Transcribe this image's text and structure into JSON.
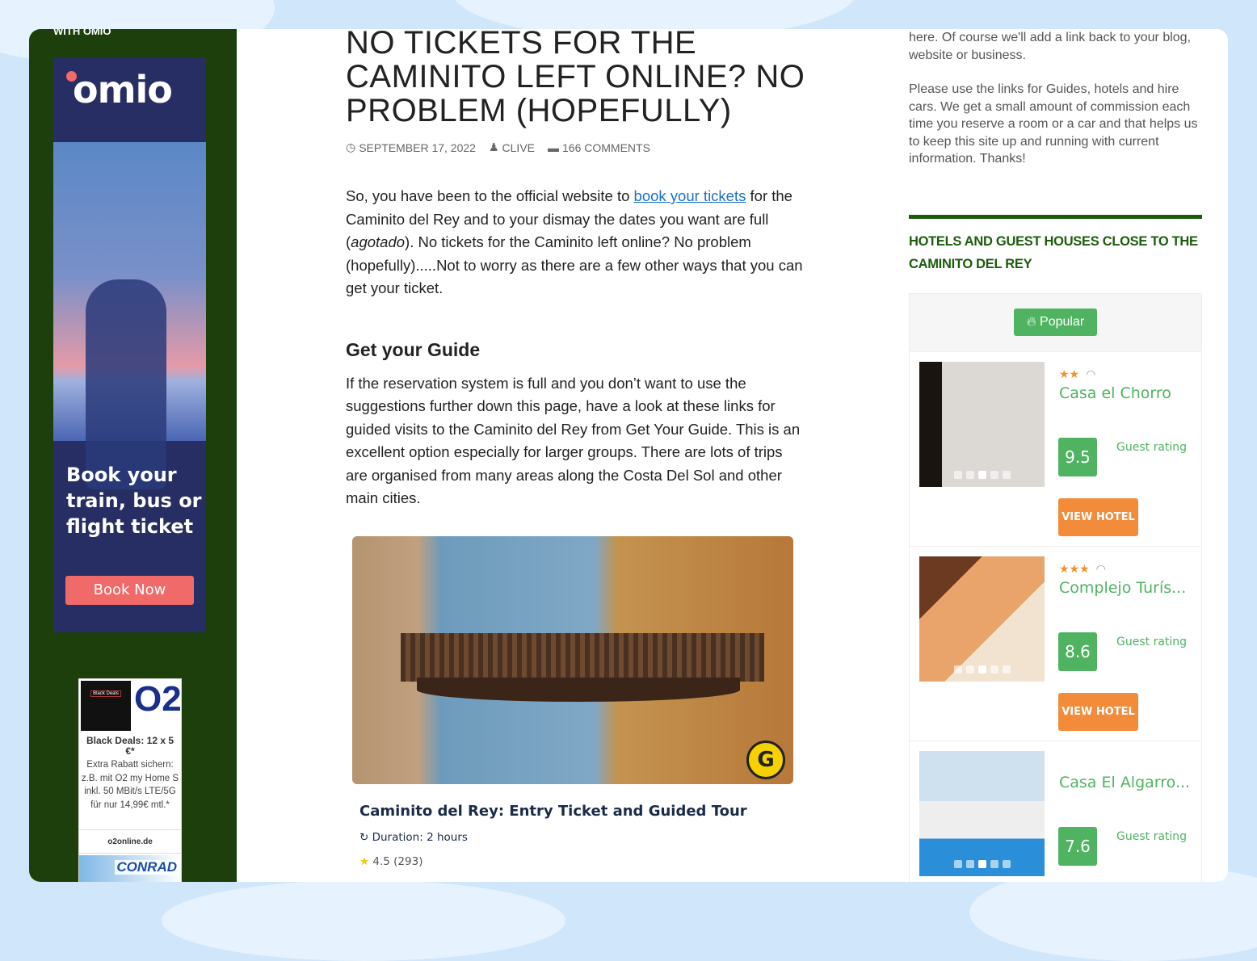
{
  "sidebar": {
    "heading": "WITH OMIO",
    "omio_ad": {
      "logo": "omio",
      "text": "Book your train, bus or flight ticket",
      "button": "Book Now"
    },
    "o2_ad": {
      "badge": "Black Deals",
      "logo": "O2",
      "headline": "Black Deals: 12 x 5 €*",
      "text": "Extra Rabatt sichern: z.B. mit O2 my Home S inkl. 50 MBit/s LTE/5G für nur 14,99€ mtl.*",
      "site": "o2online.de",
      "next_ad": "CONRAD"
    }
  },
  "article": {
    "title": "NO TICKETS FOR THE CAMINITO LEFT ONLINE? NO PROBLEM (HOPEFULLY)",
    "date": "SEPTEMBER 17, 2022",
    "author": "CLIVE",
    "comments": "166 COMMENTS",
    "intro_a": "So, you have been to the official website to ",
    "intro_link": "book your tickets",
    "intro_b": " for the Caminito del Rey and to your dismay the dates you want are full (",
    "intro_em": "agotado",
    "intro_c": "). No tickets for the Caminito left online? No problem (hopefully).....Not to worry as there are a few other ways that you can get your ticket.",
    "h2": "Get your Guide",
    "p2": "If the reservation system is full and you don’t want to use the suggestions further down this page, have a look at these links for guided visits to the Caminito del Rey from Get Your Guide. This is an excellent option especially for larger groups. There are lots of trips are organised from many areas along the Costa Del Sol and other main cities.",
    "tour": {
      "title": "Caminito del Rey: Entry Ticket and Guided Tour",
      "duration": "Duration: 2 hours",
      "rating": "4.5 (293)",
      "badge": "G"
    }
  },
  "right": {
    "p1": "here. Of course we'll add a link back to your blog, website or business.",
    "p2": "Please use the links for Guides, hotels and hire cars. We get a small amount of commission each time you reserve a room or a car and that helps us to keep this site up and running with current information. Thanks!",
    "heading": "HOTELS AND GUEST HOUSES CLOSE TO THE CAMINITO DEL REY",
    "popular": "Popular",
    "hotels": [
      {
        "stars": "★★",
        "name": "Casa el Chorro",
        "score": "9.5",
        "rating_label": "Guest rating",
        "button": "VIEW HOTEL"
      },
      {
        "stars": "★★★",
        "name": "Complejo Turís...",
        "score": "8.6",
        "rating_label": "Guest rating",
        "button": "VIEW HOTEL"
      },
      {
        "stars": "",
        "name": "Casa El Algarro...",
        "score": "7.6",
        "rating_label": "Guest rating",
        "button": ""
      }
    ]
  },
  "colors": {
    "sidebar": "#1c3f0c",
    "accent_green": "#4fb361",
    "orange": "#f28c3b",
    "link": "#1a73c8",
    "heading_green": "#1c5c0c"
  }
}
